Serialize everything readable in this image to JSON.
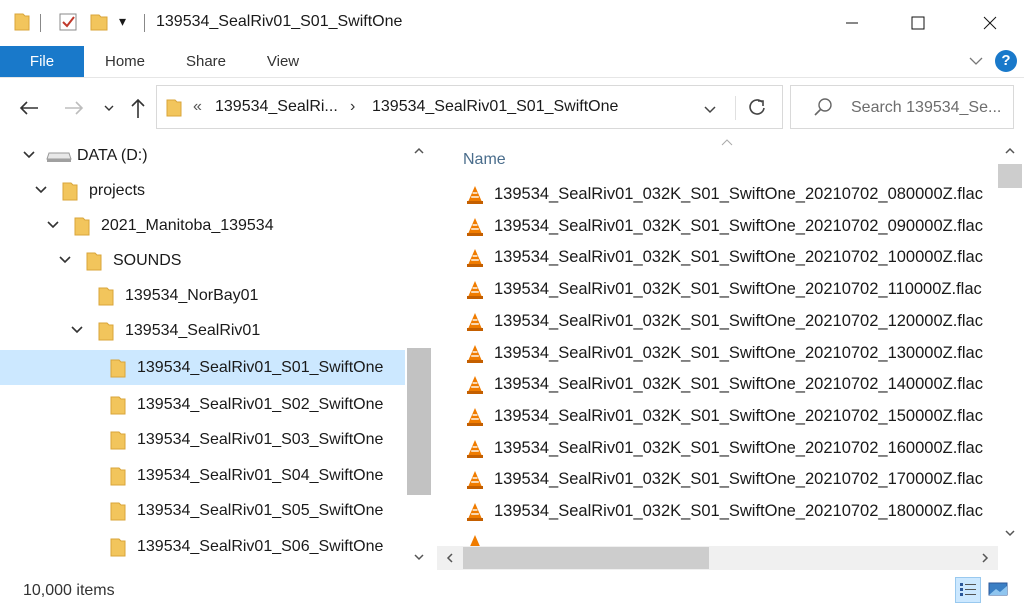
{
  "window": {
    "title": "139534_SealRiv01_S01_SwiftOne",
    "quick_access_dropdown": "▾",
    "minimize": "—",
    "maximize": "☐",
    "close": "✕"
  },
  "ribbon": {
    "tabs": [
      "File",
      "Home",
      "Share",
      "View"
    ],
    "help": "?"
  },
  "address": {
    "overflow": "«",
    "segments": [
      "139534_SealRi...",
      "139534_SealRiv01_S01_SwiftOne"
    ],
    "separator": "›",
    "search_placeholder": "Search 139534_Se..."
  },
  "nav_tree": [
    {
      "label": "DATA (D:)",
      "icon": "drive-icon",
      "expanded": true
    },
    {
      "label": "projects",
      "icon": "folder-icon",
      "expanded": true
    },
    {
      "label": "2021_Manitoba_139534",
      "icon": "folder-icon",
      "expanded": true
    },
    {
      "label": "SOUNDS",
      "icon": "folder-icon",
      "expanded": true
    },
    {
      "label": "139534_NorBay01",
      "icon": "folder-icon",
      "expanded": false
    },
    {
      "label": "139534_SealRiv01",
      "icon": "folder-icon",
      "expanded": true
    },
    {
      "label": "139534_SealRiv01_S01_SwiftOne",
      "icon": "folder-icon",
      "selected": true
    },
    {
      "label": "139534_SealRiv01_S02_SwiftOne",
      "icon": "folder-icon"
    },
    {
      "label": "139534_SealRiv01_S03_SwiftOne",
      "icon": "folder-icon"
    },
    {
      "label": "139534_SealRiv01_S04_SwiftOne",
      "icon": "folder-icon"
    },
    {
      "label": "139534_SealRiv01_S05_SwiftOne",
      "icon": "folder-icon"
    },
    {
      "label": "139534_SealRiv01_S06_SwiftOne",
      "icon": "folder-icon"
    }
  ],
  "content": {
    "column_header": "Name",
    "files": [
      "139534_SealRiv01_032K_S01_SwiftOne_20210702_080000Z.flac",
      "139534_SealRiv01_032K_S01_SwiftOne_20210702_090000Z.flac",
      "139534_SealRiv01_032K_S01_SwiftOne_20210702_100000Z.flac",
      "139534_SealRiv01_032K_S01_SwiftOne_20210702_110000Z.flac",
      "139534_SealRiv01_032K_S01_SwiftOne_20210702_120000Z.flac",
      "139534_SealRiv01_032K_S01_SwiftOne_20210702_130000Z.flac",
      "139534_SealRiv01_032K_S01_SwiftOne_20210702_140000Z.flac",
      "139534_SealRiv01_032K_S01_SwiftOne_20210702_150000Z.flac",
      "139534_SealRiv01_032K_S01_SwiftOne_20210702_160000Z.flac",
      "139534_SealRiv01_032K_S01_SwiftOne_20210702_170000Z.flac",
      "139534_SealRiv01_032K_S01_SwiftOne_20210702_180000Z.flac"
    ]
  },
  "status": {
    "item_count": "10,000 items"
  },
  "colors": {
    "accent": "#1979ca",
    "selection": "#cce8ff",
    "folder": "#f2c55c",
    "vlc_orange": "#f07c00"
  }
}
